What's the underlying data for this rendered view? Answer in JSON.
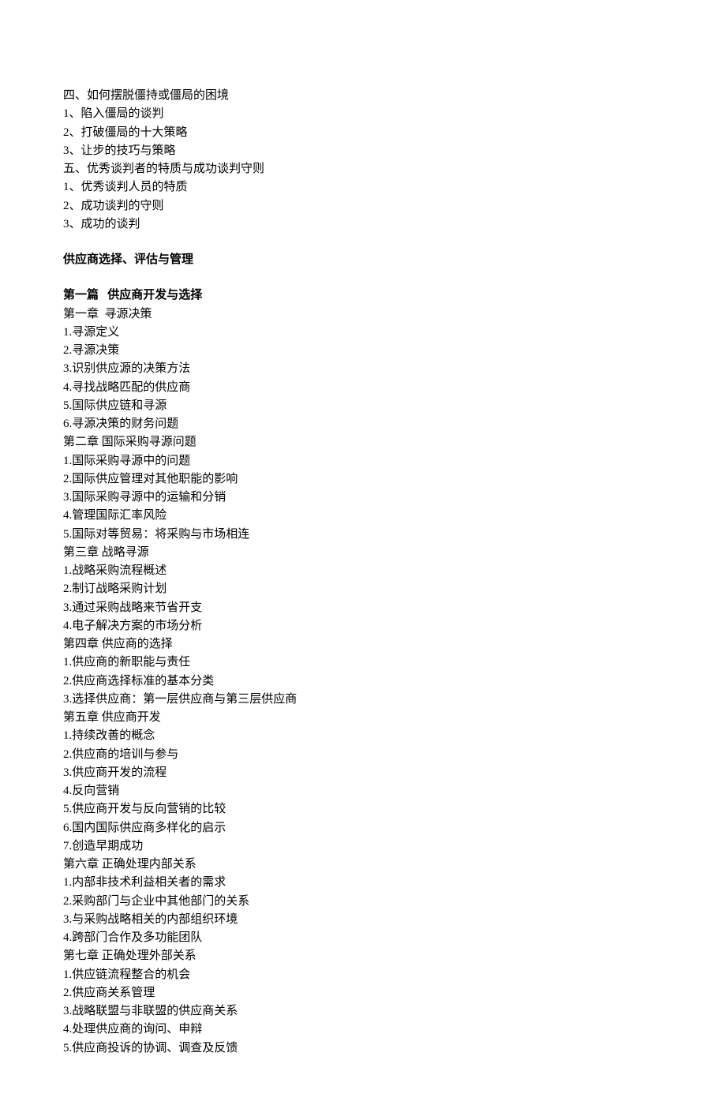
{
  "section1": {
    "lines": [
      "四、如何摆脱僵持或僵局的困境",
      "1、陷入僵局的谈判",
      "2、打破僵局的十大策略",
      "3、让步的技巧与策略",
      "五、优秀谈判者的特质与成功谈判守则",
      "1、优秀谈判人员的特质",
      "2、成功谈判的守则",
      "3、成功的谈判"
    ]
  },
  "heading1": "供应商选择、评估与管理",
  "heading2": "第一篇   供应商开发与选择",
  "section2": {
    "lines": [
      "第一章  寻源决策",
      "1.寻源定义",
      "2.寻源决策",
      "3.识别供应源的决策方法",
      "4.寻找战略匹配的供应商",
      "5.国际供应链和寻源",
      "6.寻源决策的财务问题",
      "第二章 国际采购寻源问题",
      "1.国际采购寻源中的问题",
      "2.国际供应管理对其他职能的影响",
      "3.国际采购寻源中的运输和分销",
      "4.管理国际汇率风险",
      "5.国际对等贸易：将采购与市场相连",
      "第三章 战略寻源",
      "1.战略采购流程概述",
      "2.制订战略采购计划",
      "3.通过采购战略来节省开支",
      "4.电子解决方案的市场分析",
      "第四章 供应商的选择",
      "1.供应商的新职能与责任",
      "2.供应商选择标准的基本分类",
      "3.选择供应商：第一层供应商与第三层供应商",
      "第五章 供应商开发",
      "1.持续改善的概念",
      "2.供应商的培训与参与",
      "3.供应商开发的流程",
      "4.反向营销",
      "5.供应商开发与反向营销的比较",
      "6.国内国际供应商多样化的启示",
      "7.创造早期成功",
      "第六章 正确处理内部关系",
      "1.内部非技术利益相关者的需求",
      "2.采购部门与企业中其他部门的关系",
      "3.与采购战略相关的内部组织环境",
      "4.跨部门合作及多功能团队",
      "第七章 正确处理外部关系",
      "1.供应链流程整合的机会",
      "2.供应商关系管理",
      "3.战略联盟与非联盟的供应商关系",
      "4.处理供应商的询问、申辩",
      "5.供应商投诉的协调、调查及反馈"
    ]
  }
}
